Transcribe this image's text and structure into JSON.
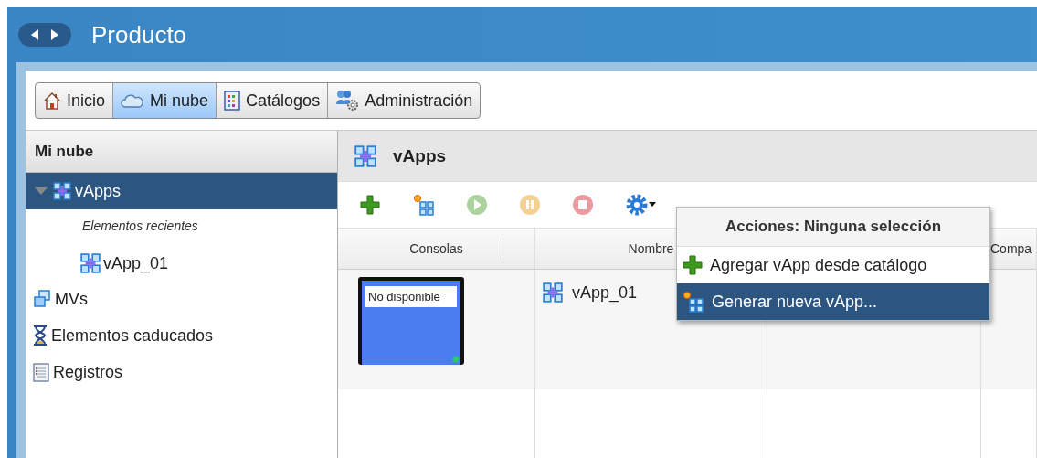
{
  "window": {
    "title": "Producto"
  },
  "nav_tabs": [
    {
      "label": "Inicio",
      "selected": false
    },
    {
      "label": "Mi nube",
      "selected": true
    },
    {
      "label": "Catálogos",
      "selected": false
    },
    {
      "label": "Administración",
      "selected": false
    }
  ],
  "sidebar": {
    "title": "Mi nube",
    "items": [
      {
        "label": "vApps",
        "selected": true,
        "expanded": true,
        "children": [
          {
            "kind": "heading",
            "label": "Elementos recientes"
          },
          {
            "kind": "item",
            "label": "vApp_01"
          }
        ]
      },
      {
        "label": "MVs",
        "selected": false
      },
      {
        "label": "Elementos caducados",
        "selected": false
      },
      {
        "label": "Registros",
        "selected": false
      }
    ]
  },
  "main": {
    "title": "vApps",
    "toolbar": [
      {
        "disabled": false
      },
      {
        "disabled": false
      },
      {
        "disabled": true
      },
      {
        "disabled": true
      },
      {
        "disabled": true
      },
      {
        "disabled": false
      }
    ],
    "table": {
      "columns": [
        "Consolas",
        "Nombre",
        "Compa"
      ],
      "rows": [
        {
          "console": "No disponible",
          "name": "vApp_01"
        }
      ]
    },
    "menu": {
      "title": "Acciones: Ninguna selección",
      "items": [
        {
          "label": "Agregar vApp desde catálogo",
          "selected": false
        },
        {
          "label": "Generar nueva vApp...",
          "selected": true
        }
      ]
    }
  }
}
